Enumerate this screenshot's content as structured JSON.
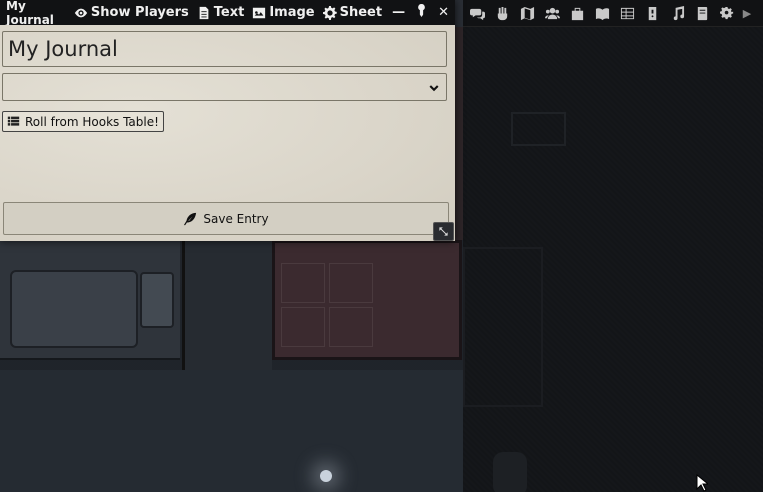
{
  "journal": {
    "title": "My Journal",
    "header_buttons": {
      "show_players": "Show Players",
      "text": "Text",
      "image": "Image",
      "sheet": "Sheet"
    },
    "controls": {
      "minimize": "—",
      "pin": "pin-icon",
      "close": "✕"
    },
    "name_value": "My Journal",
    "type_select_value": "",
    "roll_button_label": "Roll from Hooks Table!",
    "save_button_label": "Save Entry"
  },
  "toolbar": {
    "icons": [
      "chat-icon",
      "combat-icon",
      "scenes-icon",
      "actors-icon",
      "items-icon",
      "journal-icon",
      "tables-icon",
      "cards-icon",
      "playlists-icon",
      "compendium-icon",
      "settings-icon",
      "collapse-icon"
    ]
  },
  "colors": {
    "panel_bg": "#dcd7cb",
    "header_bg": "#111214",
    "fog_bg": "#15171a"
  }
}
